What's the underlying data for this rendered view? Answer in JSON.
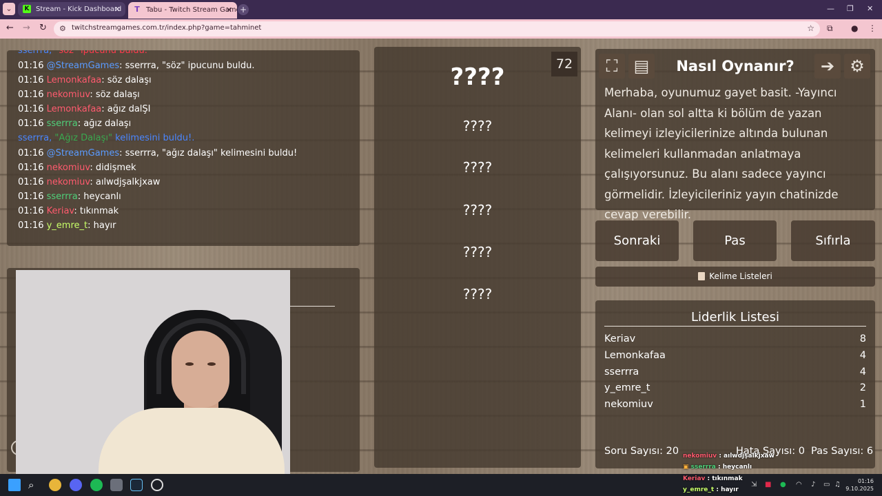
{
  "browser": {
    "tabs": [
      {
        "label": "Stream - Kick Dashboard",
        "favicon": "K"
      },
      {
        "label": "Tabu - Twitch Stream Games",
        "favicon": "T"
      }
    ],
    "url": "twitchstreamgames.com.tr/index.php?game=tahminet"
  },
  "chat": {
    "lines": [
      {
        "time": "",
        "user": "sserrra,",
        "text": " \"söz\" ipucunu buldu.",
        "type": "system-top"
      },
      {
        "time": "01:16",
        "user": "@StreamGames",
        "text": ": sserrra, \"söz\" ipucunu buldu.",
        "color": "blue"
      },
      {
        "time": "01:16",
        "user": "Lemonkafaa",
        "text": ": söz dalaşı",
        "color": "red"
      },
      {
        "time": "01:16",
        "user": "nekomiuv",
        "text": ": söz dalaşı",
        "color": "red"
      },
      {
        "time": "01:16",
        "user": "Lemonkafaa",
        "text": ": ağız dalŞI",
        "color": "red"
      },
      {
        "time": "01:16",
        "user": "sserrra",
        "text": ": ağız dalaşı",
        "color": "green"
      },
      {
        "time": "",
        "user": "sserrra,",
        "text": "\"Ağız Dalaşı\"",
        "suffix": " kelimesini buldu!.",
        "type": "system"
      },
      {
        "time": "01:16",
        "user": "@StreamGames",
        "text": ": sserrra, \"ağız dalaşı\" kelimesini buldu!",
        "color": "blue"
      },
      {
        "time": "01:16",
        "user": "nekomiuv",
        "text": ": didişmek",
        "color": "red"
      },
      {
        "time": "01:16",
        "user": "nekomiuv",
        "text": ": aılwdjşalkjxaw",
        "color": "red"
      },
      {
        "time": "01:16",
        "user": "sserrra",
        "text": ": heycanlı",
        "color": "green"
      },
      {
        "time": "01:16",
        "user": "Keriav",
        "text": ": tıkınmak",
        "color": "red"
      },
      {
        "time": "01:16",
        "user": "y_emre_t",
        "text": ": hayır",
        "color": "yellow"
      }
    ]
  },
  "game": {
    "timer": "72",
    "main_word": "????",
    "hints": [
      "????",
      "????",
      "????",
      "????",
      "????"
    ]
  },
  "howto": {
    "title": "Nasıl Oynanır?",
    "text": "Merhaba, oyunumuz gayet basit. -Yayıncı Alanı- olan sol altta ki bölüm de yazan kelimeyi izleyicilerinize altında bulunan kelimeleri kullanmadan anlatmaya çalışıyorsunuz. Bu alanı sadece yayıncı görmelidir. İzleyicileriniz yayın chatinizde cevap verebilir."
  },
  "buttons": {
    "next": "Sonraki",
    "pass": "Pas",
    "reset": "Sıfırla",
    "word_lists": "Kelime Listeleri"
  },
  "leaderboard": {
    "title": "Liderlik Listesi",
    "rows": [
      {
        "name": "Keriav",
        "points": "8"
      },
      {
        "name": "Lemonkafaa",
        "points": "4"
      },
      {
        "name": "sserrra",
        "points": "4"
      },
      {
        "name": "y_emre_t",
        "points": "2"
      },
      {
        "name": "nekomiuv",
        "points": "1"
      }
    ]
  },
  "stats": {
    "questions": "Soru Sayısı: 20",
    "errors": "Hata Sayısı: 0",
    "passes": "Pas Sayısı: 6"
  },
  "overlay_chat": [
    {
      "user": "nekomiuv",
      "text": " : aılwdjşalkjxaw"
    },
    {
      "user": "sserrra",
      "text": " : heycanlı"
    },
    {
      "user": "Keriav",
      "text": " : tıkınmak"
    },
    {
      "user": "y_emre_t",
      "text": " : hayır"
    }
  ],
  "taskbar": {
    "time": "01:16",
    "date": "9.10.2025"
  },
  "colors": {
    "accent_pink": "#f4c6d0",
    "wood": "#8d7c69",
    "panel": "#463a2f"
  }
}
